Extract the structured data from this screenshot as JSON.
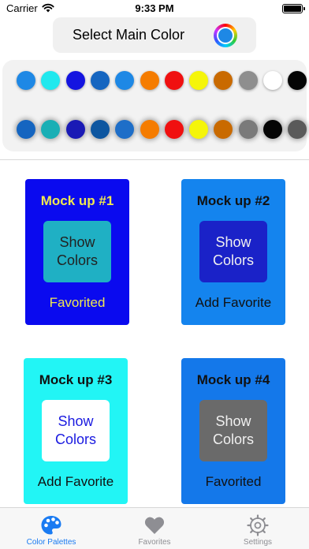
{
  "status_bar": {
    "carrier": "Carrier",
    "time": "9:33 PM"
  },
  "main_color": {
    "label": "Select Main Color",
    "selected_color": "#1e88e5"
  },
  "swatches": {
    "row1": [
      "#1e88e5",
      "#20e8ee",
      "#1414e0",
      "#1565c0",
      "#1e88e5",
      "#f57c00",
      "#f01010",
      "#f5f50a",
      "#c96a00",
      "#8e8e8e",
      "#ffffff",
      "#050505"
    ],
    "row2": [
      "#1565c0",
      "#1aafb5",
      "#1a1ab5",
      "#0d56a0",
      "#1e6ec8",
      "#f57c00",
      "#f01010",
      "#f5f50a",
      "#c96a00",
      "#7a7a7a",
      "#050505",
      "#5a5a5a"
    ]
  },
  "mockups": [
    {
      "title": "Mock up #1",
      "button": "Show Colors",
      "favorite": "Favorited",
      "colors": {
        "bg": "#0a0aef",
        "title": "#f0e850",
        "button_bg": "#1fb0c4",
        "button_text": "#222222",
        "favorite": "#f0e850"
      }
    },
    {
      "title": "Mock up #2",
      "button": "Show Colors",
      "favorite": "Add Favorite",
      "colors": {
        "bg": "#1484ee",
        "title": "#111111",
        "button_bg": "#1a22c8",
        "button_text": "#f0f0f0",
        "favorite": "#111111"
      }
    },
    {
      "title": "Mock up #3",
      "button": "Show Colors",
      "favorite": "Add Favorite",
      "colors": {
        "bg": "#22f5f5",
        "title": "#111111",
        "button_bg": "#ffffff",
        "button_text": "#1a1ae0",
        "favorite": "#111111"
      }
    },
    {
      "title": "Mock up #4",
      "button": "Show Colors",
      "favorite": "Favorited",
      "colors": {
        "bg": "#1478ea",
        "title": "#111111",
        "button_bg": "#6a6a6a",
        "button_text": "#f0f0f0",
        "favorite": "#111111"
      }
    }
  ],
  "tab_bar": {
    "tabs": [
      {
        "label": "Color Palettes",
        "icon": "palette-icon",
        "active": true
      },
      {
        "label": "Favorites",
        "icon": "heart-icon",
        "active": false
      },
      {
        "label": "Settings",
        "icon": "gear-icon",
        "active": false
      }
    ],
    "active_color": "#1a7bf2",
    "inactive_color": "#8e8e93"
  }
}
